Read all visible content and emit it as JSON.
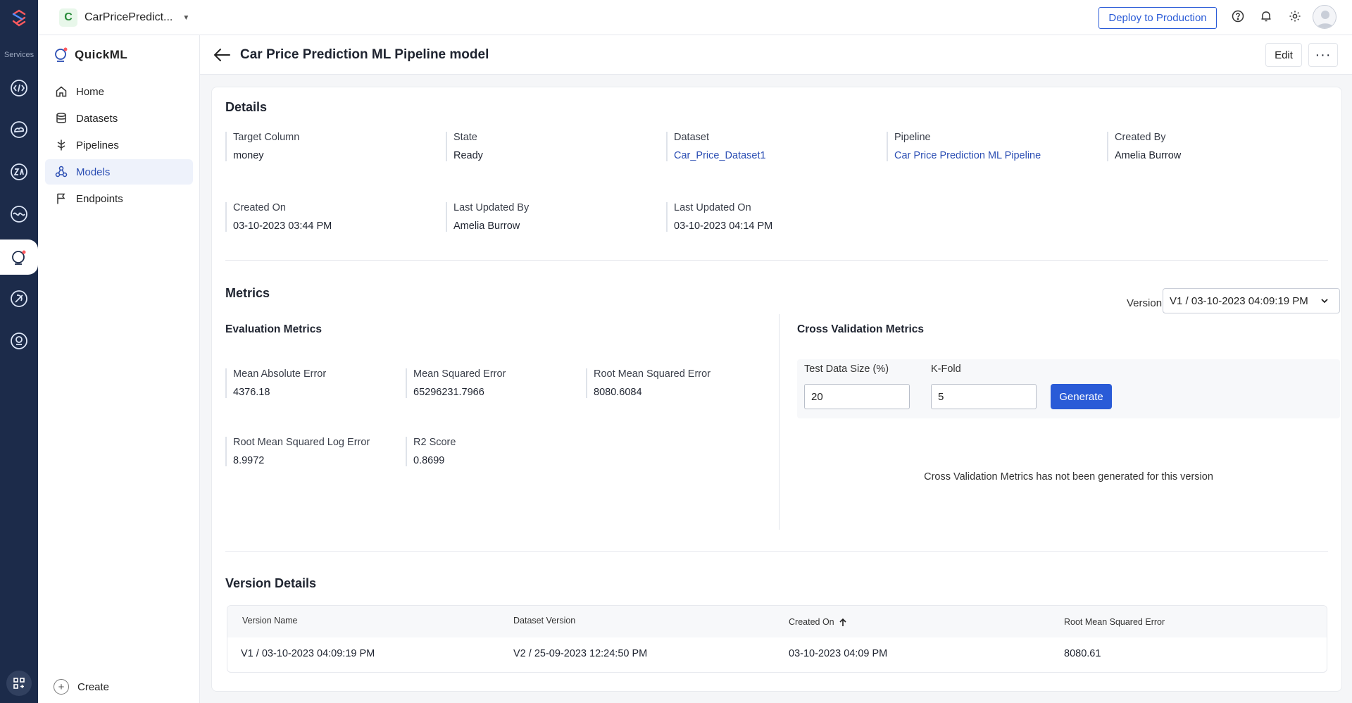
{
  "topbar": {
    "project_initial": "C",
    "project_name": "CarPricePredict...",
    "deploy_label": "Deploy to Production"
  },
  "rail": {
    "services_label": "Services"
  },
  "sidebar": {
    "brand": "QuickML",
    "items": [
      {
        "label": "Home",
        "icon": "home-icon"
      },
      {
        "label": "Datasets",
        "icon": "database-icon"
      },
      {
        "label": "Pipelines",
        "icon": "pipeline-icon"
      },
      {
        "label": "Models",
        "icon": "models-icon",
        "active": true
      },
      {
        "label": "Endpoints",
        "icon": "flag-icon"
      }
    ],
    "create_label": "Create"
  },
  "page": {
    "title": "Car Price Prediction ML Pipeline model",
    "edit_label": "Edit",
    "more_label": "···"
  },
  "details": {
    "title": "Details",
    "fields": [
      {
        "label": "Target Column",
        "value": "money"
      },
      {
        "label": "State",
        "value": "Ready"
      },
      {
        "label": "Dataset",
        "value": "Car_Price_Dataset1",
        "link": true
      },
      {
        "label": "Pipeline",
        "value": "Car Price Prediction ML Pipeline",
        "link": true
      },
      {
        "label": "Created By",
        "value": "Amelia Burrow"
      },
      {
        "label": "Created On",
        "value": "03-10-2023 03:44 PM"
      },
      {
        "label": "Last Updated By",
        "value": "Amelia Burrow"
      },
      {
        "label": "Last Updated On",
        "value": "03-10-2023 04:14 PM"
      }
    ]
  },
  "metrics": {
    "title": "Metrics",
    "version_label": "Version",
    "version_value": "V1 / 03-10-2023 04:09:19 PM",
    "evaluation_title": "Evaluation Metrics",
    "evaluation": [
      {
        "label": "Mean Absolute Error",
        "value": "4376.18"
      },
      {
        "label": "Mean Squared Error",
        "value": "65296231.7966"
      },
      {
        "label": "Root Mean Squared Error",
        "value": "8080.6084"
      },
      {
        "label": "Root Mean Squared Log Error",
        "value": "8.9972"
      },
      {
        "label": "R2 Score",
        "value": "0.8699"
      }
    ],
    "cross_validation": {
      "title": "Cross Validation Metrics",
      "test_size_label": "Test Data Size (%)",
      "test_size_value": "20",
      "kfold_label": "K-Fold",
      "kfold_value": "5",
      "generate_label": "Generate",
      "empty_message": "Cross Validation Metrics has not been generated for this version"
    }
  },
  "version_details": {
    "title": "Version Details",
    "columns": [
      "Version Name",
      "Dataset Version",
      "Created On",
      "Root Mean Squared Error"
    ],
    "rows": [
      [
        "V1 / 03-10-2023 04:09:19 PM",
        "V2 / 25-09-2023 12:24:50 PM",
        "03-10-2023 04:09 PM",
        "8080.61"
      ]
    ]
  },
  "colors": {
    "rail": "#1c2b4a",
    "accent": "#2a5bd7",
    "link": "#2a4db3",
    "active_nav_bg": "#eef2fb"
  }
}
